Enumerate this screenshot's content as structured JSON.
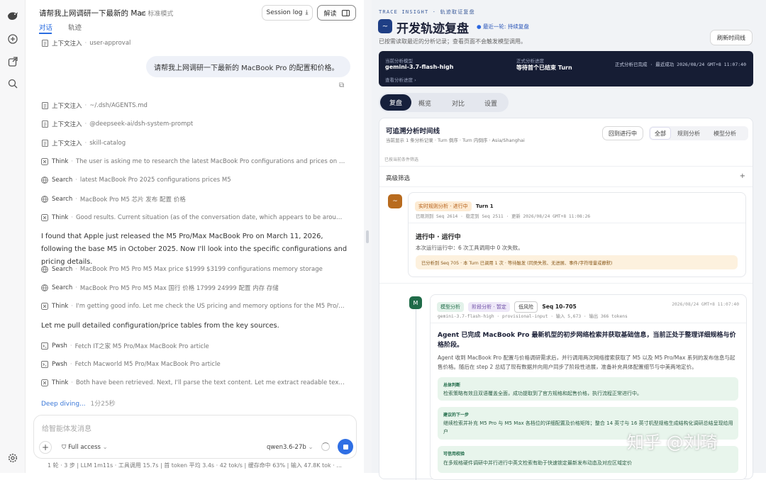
{
  "rail": {
    "icons": [
      "app-logo-icon",
      "new-chat-icon",
      "share-icon",
      "search-icon",
      "settings-icon"
    ]
  },
  "chat": {
    "title": "请帮我上网调研一下最新的 Mac",
    "mode": "标准模式",
    "session_log": "Session log",
    "interpret": "解读",
    "tabs": [
      "对话",
      "轨迹"
    ],
    "user_message": "请帮我上网调研一下最新的 MacBook Pro 的配置和价格。",
    "events_top": [
      {
        "type": "上下文注入",
        "detail": "user-approval",
        "icon": "doc"
      }
    ],
    "events_ctx": [
      {
        "type": "上下文注入",
        "detail": "~/.dsh/AGENTS.md",
        "icon": "doc"
      },
      {
        "type": "上下文注入",
        "detail": "@deepseek-ai/dsh-system-prompt",
        "icon": "doc"
      },
      {
        "type": "上下文注入",
        "detail": "skill-catalog",
        "icon": "doc"
      },
      {
        "type": "Think",
        "detail": "The user is asking me to research the latest MacBook Pro configurations and prices on the we...",
        "icon": "think"
      },
      {
        "type": "Search",
        "detail": "latest MacBook Pro 2025 configurations prices M5",
        "icon": "globe"
      },
      {
        "type": "Search",
        "detail": "MacBook Pro M5 芯片 发布 配置 价格",
        "icon": "globe"
      },
      {
        "type": "Think",
        "detail": "Good results. Current situation (as of the conversation date, which appears to be around Marc...",
        "icon": "think"
      }
    ],
    "assistant_1": "I found that Apple just released the M5 Pro/Max MacBook Pro on March 11, 2026, following the base M5 in October 2025. Now I'll look into the specific configurations and pricing details.",
    "events_mid": [
      {
        "type": "Search",
        "detail": "MacBook Pro M5 Pro M5 Max price $1999 $3199 configurations memory storage",
        "icon": "globe"
      },
      {
        "type": "Search",
        "detail": "MacBook Pro M5 Pro M5 Max 国行 价格 17999 24999 配置 内存 存储",
        "icon": "globe"
      },
      {
        "type": "Think",
        "detail": "I'm getting good info. Let me check the US pricing and memory options for the M5 Pro/Max ...",
        "icon": "think"
      }
    ],
    "assistant_2": "Let me pull detailed configuration/price tables from the key sources.",
    "events_bottom": [
      {
        "type": "Pwsh",
        "detail": "Fetch IT之家 M5 Pro/Max MacBook Pro article",
        "icon": "term"
      },
      {
        "type": "Pwsh",
        "detail": "Fetch Macworld M5 Pro/Max MacBook Pro article",
        "icon": "term"
      },
      {
        "type": "Think",
        "detail": "Both have been retrieved. Next, I'll parse the text content. Let me extract readable text from b...",
        "icon": "think"
      }
    ],
    "deep_diving": "Deep diving...",
    "elapsed": "1分25秒",
    "input_placeholder": "给智能体发消息",
    "access": "Full access",
    "model": "qwen3.6-27b",
    "footer": "1 轮 · 3 步  |  LLM 1m11s · 工具调用 15.7s  |  首 token 平均 3.4s · 42 tok/s  |  缓存命中 63%  |  输入 47.8K tok · ..."
  },
  "trace": {
    "kicker": "TRACE INSIGHT · 轨迹取证复盘",
    "title": "开发轨迹复盘",
    "live_badge": "最近一轮: 持续复盘",
    "subtitle": "已按需读取最近的分析记录；查看页面不会触发模型调用。",
    "refresh": "刷新时间线",
    "banner": {
      "model_label": "当前分析模型",
      "model": "gemini-3.7-flash-high",
      "progress_label": "正式分析进度",
      "progress": "等待首个已结束 Turn",
      "right": "正式分析已完成 · 最近成功 2026/08/24 GMT+8 11:07:40",
      "view_progress": "查看分析进度 ›"
    },
    "tabs": [
      "复盘",
      "概览",
      "对比",
      "设置"
    ],
    "timeline": {
      "title": "可追溯分析时间线",
      "sub": "当前显示 1 条分析记录 · Turn 倒序 · Turn 内倒序 · Asia/Shanghai",
      "back": "回到进行中",
      "filters": [
        "全部",
        "规则分析",
        "模型分析"
      ],
      "empty": "已按当前条件筛选",
      "advanced": "高级筛选",
      "plus": "+"
    },
    "turn": {
      "tag": "实时规则分析 · 进行中",
      "label": "Turn 1",
      "meta": "已观测到 Seq 2614 · 稳定到 Seq 2511 · 更新 2026/08/24 GMT+8 11:08:26",
      "status_title": "进行中 · 运行中",
      "status_desc": "本次运行运行中：6 次工具调用中 0 次失败。",
      "notice": "已分析到 Seq 705 · 本 Turn 已调用 1 次 · 等待触发 (同类失败、无进展、事件/字符增量或静默)"
    },
    "analysis": {
      "tags": [
        "模型分析",
        "阶段分析 · 暂定",
        "低风险"
      ],
      "seq": "Seq 10–705",
      "time": "2026/08/24 GMT+8 11:07:40",
      "meta": "gemini-3.7-flash-high · provisional-input · 输入 5,673 · 输出 366 tokens",
      "headline": "Agent 已完成 MacBook Pro 最新机型的初步网络检索并获取基础信息，当前正处于整理详细规格与价格阶段。",
      "body": "Agent 收到 MacBook Pro 配置与价格调研需求后，并行调用两次网络搜索获取了 M5 以及 M5 Pro/Max 系列的发布信息与起售价格。随后在 step 2 总结了现有数据并向用户同步了阶段性进展，准备补充具体配置细节与中美两地定价。",
      "blocks": [
        {
          "label": "总体判断",
          "text": "检索策略有效且双语覆盖全面，成功提取到了官方规格和起售价格，执行流程正常进行中。"
        },
        {
          "label": "建议的下一步",
          "text": "继续检索并补充 M5 Pro 与 M5 Max 各档位的详细配置及价格矩阵；整合 14 英寸与 16 英寸机型规格生成结构化调研总结呈现给用户"
        },
        {
          "label": "可信用校验",
          "text": "在多规格硬件调研中并行进行中英文检索有助于快速锁定最新发布动态及对应区域定价"
        }
      ]
    },
    "watermark": "知乎 @刘琦"
  }
}
